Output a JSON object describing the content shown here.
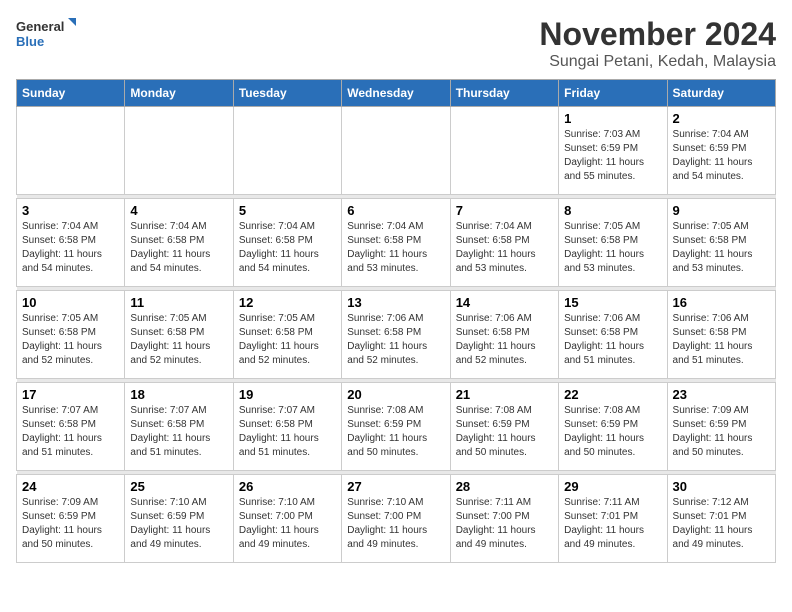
{
  "header": {
    "logo_general": "General",
    "logo_blue": "Blue",
    "month_title": "November 2024",
    "subtitle": "Sungai Petani, Kedah, Malaysia"
  },
  "weekdays": [
    "Sunday",
    "Monday",
    "Tuesday",
    "Wednesday",
    "Thursday",
    "Friday",
    "Saturday"
  ],
  "weeks": [
    [
      {
        "day": "",
        "info": ""
      },
      {
        "day": "",
        "info": ""
      },
      {
        "day": "",
        "info": ""
      },
      {
        "day": "",
        "info": ""
      },
      {
        "day": "",
        "info": ""
      },
      {
        "day": "1",
        "info": "Sunrise: 7:03 AM\nSunset: 6:59 PM\nDaylight: 11 hours and 55 minutes."
      },
      {
        "day": "2",
        "info": "Sunrise: 7:04 AM\nSunset: 6:59 PM\nDaylight: 11 hours and 54 minutes."
      }
    ],
    [
      {
        "day": "3",
        "info": "Sunrise: 7:04 AM\nSunset: 6:58 PM\nDaylight: 11 hours and 54 minutes."
      },
      {
        "day": "4",
        "info": "Sunrise: 7:04 AM\nSunset: 6:58 PM\nDaylight: 11 hours and 54 minutes."
      },
      {
        "day": "5",
        "info": "Sunrise: 7:04 AM\nSunset: 6:58 PM\nDaylight: 11 hours and 54 minutes."
      },
      {
        "day": "6",
        "info": "Sunrise: 7:04 AM\nSunset: 6:58 PM\nDaylight: 11 hours and 53 minutes."
      },
      {
        "day": "7",
        "info": "Sunrise: 7:04 AM\nSunset: 6:58 PM\nDaylight: 11 hours and 53 minutes."
      },
      {
        "day": "8",
        "info": "Sunrise: 7:05 AM\nSunset: 6:58 PM\nDaylight: 11 hours and 53 minutes."
      },
      {
        "day": "9",
        "info": "Sunrise: 7:05 AM\nSunset: 6:58 PM\nDaylight: 11 hours and 53 minutes."
      }
    ],
    [
      {
        "day": "10",
        "info": "Sunrise: 7:05 AM\nSunset: 6:58 PM\nDaylight: 11 hours and 52 minutes."
      },
      {
        "day": "11",
        "info": "Sunrise: 7:05 AM\nSunset: 6:58 PM\nDaylight: 11 hours and 52 minutes."
      },
      {
        "day": "12",
        "info": "Sunrise: 7:05 AM\nSunset: 6:58 PM\nDaylight: 11 hours and 52 minutes."
      },
      {
        "day": "13",
        "info": "Sunrise: 7:06 AM\nSunset: 6:58 PM\nDaylight: 11 hours and 52 minutes."
      },
      {
        "day": "14",
        "info": "Sunrise: 7:06 AM\nSunset: 6:58 PM\nDaylight: 11 hours and 52 minutes."
      },
      {
        "day": "15",
        "info": "Sunrise: 7:06 AM\nSunset: 6:58 PM\nDaylight: 11 hours and 51 minutes."
      },
      {
        "day": "16",
        "info": "Sunrise: 7:06 AM\nSunset: 6:58 PM\nDaylight: 11 hours and 51 minutes."
      }
    ],
    [
      {
        "day": "17",
        "info": "Sunrise: 7:07 AM\nSunset: 6:58 PM\nDaylight: 11 hours and 51 minutes."
      },
      {
        "day": "18",
        "info": "Sunrise: 7:07 AM\nSunset: 6:58 PM\nDaylight: 11 hours and 51 minutes."
      },
      {
        "day": "19",
        "info": "Sunrise: 7:07 AM\nSunset: 6:58 PM\nDaylight: 11 hours and 51 minutes."
      },
      {
        "day": "20",
        "info": "Sunrise: 7:08 AM\nSunset: 6:59 PM\nDaylight: 11 hours and 50 minutes."
      },
      {
        "day": "21",
        "info": "Sunrise: 7:08 AM\nSunset: 6:59 PM\nDaylight: 11 hours and 50 minutes."
      },
      {
        "day": "22",
        "info": "Sunrise: 7:08 AM\nSunset: 6:59 PM\nDaylight: 11 hours and 50 minutes."
      },
      {
        "day": "23",
        "info": "Sunrise: 7:09 AM\nSunset: 6:59 PM\nDaylight: 11 hours and 50 minutes."
      }
    ],
    [
      {
        "day": "24",
        "info": "Sunrise: 7:09 AM\nSunset: 6:59 PM\nDaylight: 11 hours and 50 minutes."
      },
      {
        "day": "25",
        "info": "Sunrise: 7:10 AM\nSunset: 6:59 PM\nDaylight: 11 hours and 49 minutes."
      },
      {
        "day": "26",
        "info": "Sunrise: 7:10 AM\nSunset: 7:00 PM\nDaylight: 11 hours and 49 minutes."
      },
      {
        "day": "27",
        "info": "Sunrise: 7:10 AM\nSunset: 7:00 PM\nDaylight: 11 hours and 49 minutes."
      },
      {
        "day": "28",
        "info": "Sunrise: 7:11 AM\nSunset: 7:00 PM\nDaylight: 11 hours and 49 minutes."
      },
      {
        "day": "29",
        "info": "Sunrise: 7:11 AM\nSunset: 7:01 PM\nDaylight: 11 hours and 49 minutes."
      },
      {
        "day": "30",
        "info": "Sunrise: 7:12 AM\nSunset: 7:01 PM\nDaylight: 11 hours and 49 minutes."
      }
    ]
  ]
}
